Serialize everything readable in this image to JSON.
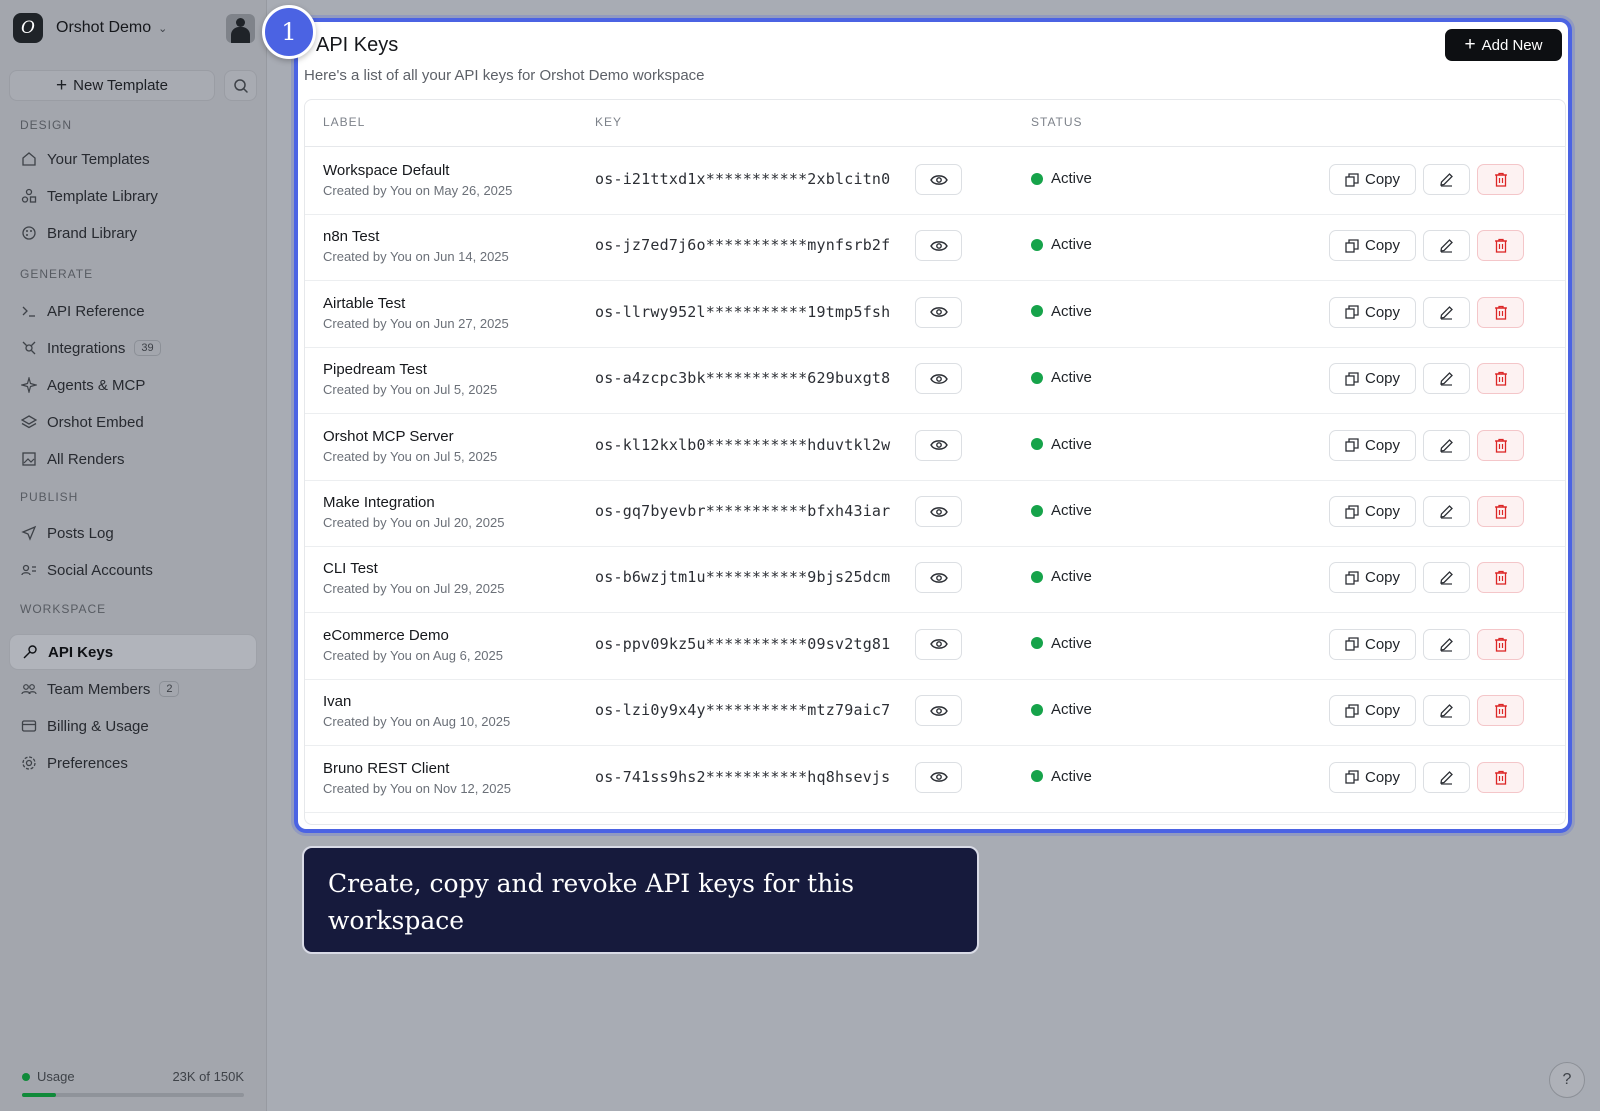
{
  "workspace": {
    "name": "Orshot Demo"
  },
  "sidebar": {
    "new_template_label": "New Template",
    "sections": [
      {
        "title": "DESIGN"
      },
      {
        "title": "GENERATE"
      },
      {
        "title": "PUBLISH"
      },
      {
        "title": "WORKSPACE"
      }
    ],
    "items": [
      {
        "label": "Your Templates",
        "icon": "home-icon"
      },
      {
        "label": "Template Library",
        "icon": "shapes-icon"
      },
      {
        "label": "Brand Library",
        "icon": "palette-icon"
      },
      {
        "label": "API Reference",
        "icon": "terminal-icon"
      },
      {
        "label": "Integrations",
        "icon": "plug-icon",
        "badge": "39"
      },
      {
        "label": "Agents & MCP",
        "icon": "sparkle-icon"
      },
      {
        "label": "Orshot Embed",
        "icon": "layers-icon"
      },
      {
        "label": "All Renders",
        "icon": "image-icon"
      },
      {
        "label": "Posts Log",
        "icon": "send-icon"
      },
      {
        "label": "Social Accounts",
        "icon": "user-list-icon"
      },
      {
        "label": "API Keys",
        "icon": "key-icon",
        "active": true
      },
      {
        "label": "Team Members",
        "icon": "team-icon",
        "badge": "2"
      },
      {
        "label": "Billing & Usage",
        "icon": "card-icon"
      },
      {
        "label": "Preferences",
        "icon": "gear-icon"
      }
    ],
    "usage": {
      "label": "Usage",
      "value_text": "23K of 150K",
      "fraction": 0.153
    }
  },
  "main": {
    "title": "API Keys",
    "subtitle": "Here's a list of all your API keys for Orshot Demo workspace",
    "add_new_label": "Add New",
    "columns": [
      "LABEL",
      "KEY",
      "STATUS"
    ],
    "copy_label": "Copy",
    "rows": [
      {
        "label": "Workspace Default",
        "meta": "Created by You on May 26, 2025",
        "key": "os-i21ttxd1x***********2xblcitn0",
        "status": "Active"
      },
      {
        "label": "n8n Test",
        "meta": "Created by You on Jun 14, 2025",
        "key": "os-jz7ed7j6o***********mynfsrb2f",
        "status": "Active"
      },
      {
        "label": "Airtable Test",
        "meta": "Created by You on Jun 27, 2025",
        "key": "os-llrwy952l***********19tmp5fsh",
        "status": "Active"
      },
      {
        "label": "Pipedream Test",
        "meta": "Created by You on Jul 5, 2025",
        "key": "os-a4zcpc3bk***********629buxgt8",
        "status": "Active"
      },
      {
        "label": "Orshot MCP Server",
        "meta": "Created by You on Jul 5, 2025",
        "key": "os-kl12kxlb0***********hduvtkl2w",
        "status": "Active"
      },
      {
        "label": "Make Integration",
        "meta": "Created by You on Jul 20, 2025",
        "key": "os-gq7byevbr***********bfxh43iar",
        "status": "Active"
      },
      {
        "label": "CLI Test",
        "meta": "Created by You on Jul 29, 2025",
        "key": "os-b6wzjtm1u***********9bjs25dcm",
        "status": "Active"
      },
      {
        "label": "eCommerce Demo",
        "meta": "Created by You on Aug 6, 2025",
        "key": "os-ppv09kz5u***********09sv2tg81",
        "status": "Active"
      },
      {
        "label": "Ivan",
        "meta": "Created by You on Aug 10, 2025",
        "key": "os-lzi0y9x4y***********mtz79aic7",
        "status": "Active"
      },
      {
        "label": "Bruno REST Client",
        "meta": "Created by You on Nov 12, 2025",
        "key": "os-741ss9hs2***********hq8hsevjs",
        "status": "Active"
      }
    ]
  },
  "tour": {
    "step": "1",
    "text": "Create, copy and revoke API keys for this workspace"
  },
  "help": {
    "label": "?"
  },
  "colors": {
    "accent": "#4b63e3",
    "status_active": "#16a34a",
    "tooltip_bg": "#161a3c",
    "danger": "#dc2626"
  }
}
